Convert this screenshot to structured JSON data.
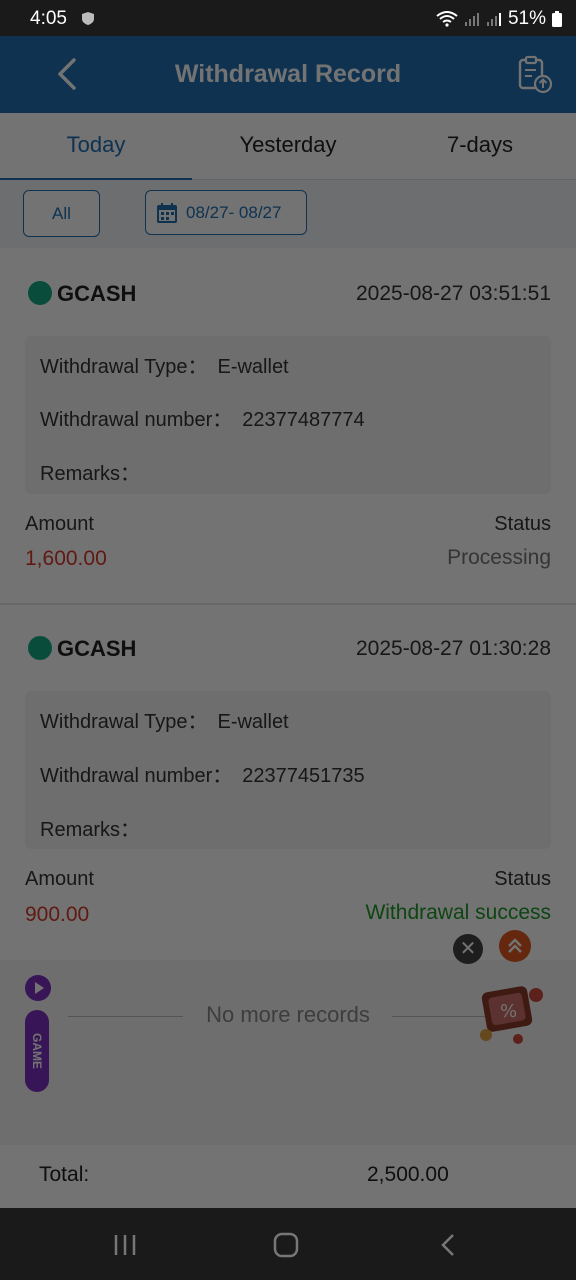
{
  "status_bar": {
    "time": "4:05",
    "battery": "51%"
  },
  "header": {
    "title": "Withdrawal Record"
  },
  "tabs": [
    {
      "label": "Today",
      "active": true
    },
    {
      "label": "Yesterday",
      "active": false
    },
    {
      "label": "7-days",
      "active": false
    }
  ],
  "filters": {
    "all_label": "All",
    "date_range": "08/27- 08/27"
  },
  "records": [
    {
      "provider": "GCASH",
      "datetime": "2025-08-27 03:51:51",
      "type_label": "Withdrawal Type：",
      "type_value": "E-wallet",
      "number_label": "Withdrawal number：",
      "number_value": "22377487774",
      "remarks_label": "Remarks：",
      "amount_label": "Amount",
      "amount_value": "1,600.00",
      "status_label": "Status",
      "status_value": "Processing",
      "status_color": "#777777"
    },
    {
      "provider": "GCASH",
      "datetime": "2025-08-27 01:30:28",
      "type_label": "Withdrawal Type：",
      "type_value": "E-wallet",
      "number_label": "Withdrawal number：",
      "number_value": "22377451735",
      "remarks_label": "Remarks：",
      "amount_label": "Amount",
      "amount_value": "900.00",
      "status_label": "Status",
      "status_value": "Withdrawal success",
      "status_color": "#1f9a2a"
    }
  ],
  "list_end_text": "No more records",
  "total": {
    "label": "Total:",
    "value": "2,500.00"
  },
  "game_tab": {
    "label": "GAME"
  },
  "colors": {
    "brand": "#1f6fb2",
    "amount": "#d43a2a"
  }
}
